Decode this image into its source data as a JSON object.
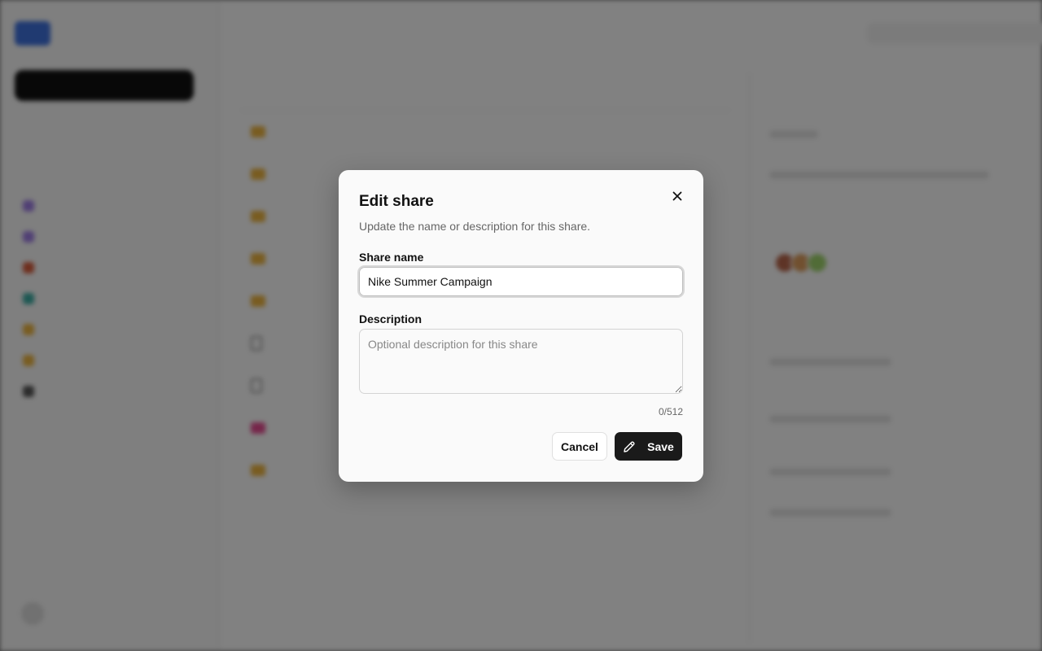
{
  "modal": {
    "title": "Edit share",
    "subtitle": "Update the name or description for this share.",
    "name_label": "Share name",
    "name_value": "Nike Summer Campaign",
    "description_label": "Description",
    "description_value": "",
    "description_placeholder": "Optional description for this share",
    "counter": "0/512",
    "cancel_label": "Cancel",
    "save_label": "Save",
    "close_icon": "close-icon",
    "save_icon": "pencil-icon"
  },
  "colors": {
    "primary_button": "#1a1a1a",
    "overlay": "rgba(0,0,0,0.48)",
    "brand": "#3e6fd9"
  }
}
